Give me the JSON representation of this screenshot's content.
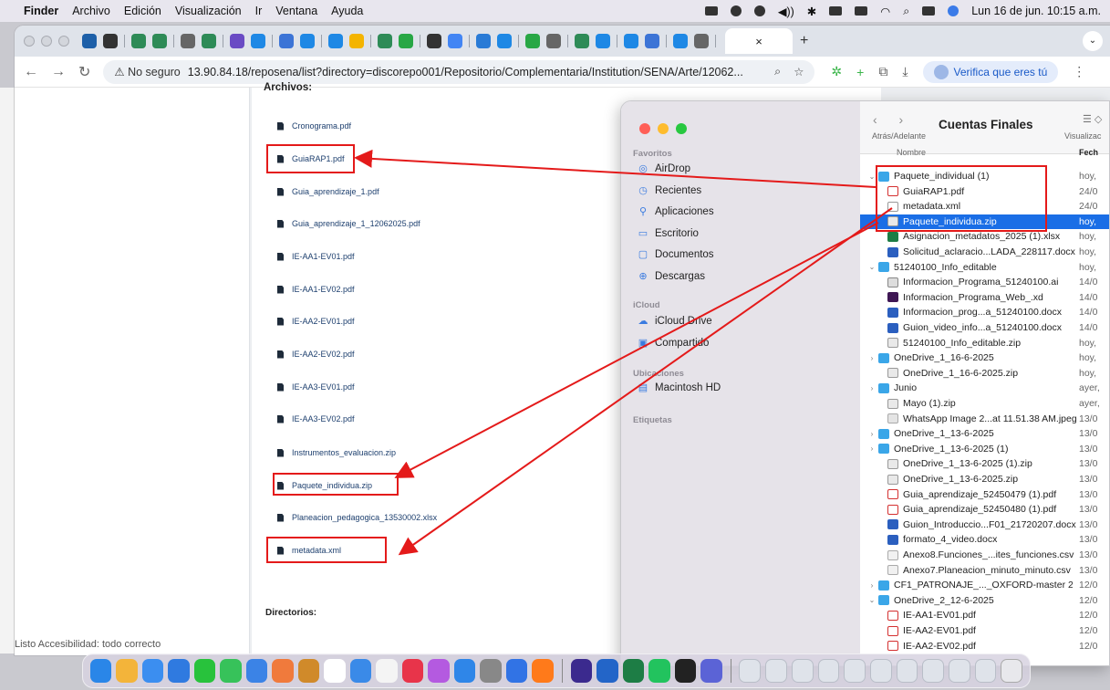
{
  "menubar": {
    "items": [
      "Finder",
      "Archivo",
      "Edición",
      "Visualización",
      "Ir",
      "Ventana",
      "Ayuda"
    ],
    "datetime": "Lun 16 de jun.  10:15 a.m."
  },
  "browser": {
    "tab_close": "×",
    "new_tab": "+",
    "security": "⚠ No seguro",
    "url": "13.90.84.18/reposena/list?directory=discorepo001/Repositorio/Complementaria/Institution/SENA/Arte/12062...",
    "verify_label": "Verifica que eres tú"
  },
  "doc": {
    "heading": "Archivos:",
    "files": [
      "Cronograma.pdf",
      "GuiaRAP1.pdf",
      "Guia_aprendizaje_1.pdf",
      "Guia_aprendizaje_1_12062025.pdf",
      "IE-AA1-EV01.pdf",
      "IE-AA1-EV02.pdf",
      "IE-AA2-EV01.pdf",
      "IE-AA2-EV02.pdf",
      "IE-AA3-EV01.pdf",
      "IE-AA3-EV02.pdf",
      "Instrumentos_evaluacion.zip",
      "Paquete_individua.zip",
      "Planeacion_pedagogica_13530002.xlsx",
      "metadata.xml"
    ],
    "dirs_heading": "Directorios:"
  },
  "status": "Listo    Accesibilidad: todo correcto",
  "finder": {
    "title": "Cuentas Finales",
    "nav_label": "Atrás/Adelante",
    "view_label": "Visualizac",
    "col_name": "Nombre",
    "col_date": "Fech",
    "sidebar": {
      "favoritos": "Favoritos",
      "fav_items": [
        "AirDrop",
        "Recientes",
        "Aplicaciones",
        "Escritorio",
        "Documentos",
        "Descargas"
      ],
      "icloud": "iCloud",
      "icloud_items": [
        "iCloud Drive",
        "Compartido"
      ],
      "ubicaciones": "Ubicaciones",
      "ubic_items": [
        "Macintosh HD"
      ],
      "etiquetas": "Etiquetas"
    },
    "rows": [
      {
        "disc": "v",
        "type": "folder",
        "name": "Paquete_individual (1)",
        "date": "hoy,"
      },
      {
        "disc": "",
        "type": "pdf",
        "name": "GuiaRAP1.pdf",
        "date": "24/0"
      },
      {
        "disc": "",
        "type": "xml",
        "name": "metadata.xml",
        "date": "24/0"
      },
      {
        "disc": "",
        "type": "zip",
        "name": "Paquete_individua.zip",
        "date": "hoy,",
        "selected": true
      },
      {
        "disc": "",
        "type": "xlsx",
        "name": "Asignacion_metadatos_2025 (1).xlsx",
        "date": "hoy,"
      },
      {
        "disc": "",
        "type": "docx",
        "name": "Solicitud_aclaracio...LADA_228117.docx",
        "date": "hoy,"
      },
      {
        "disc": "v",
        "type": "folder",
        "name": "51240100_Info_editable",
        "date": "hoy,"
      },
      {
        "disc": "",
        "type": "ai",
        "name": "Informacion_Programa_51240100.ai",
        "date": "14/0"
      },
      {
        "disc": "",
        "type": "xd",
        "name": "Informacion_Programa_Web_.xd",
        "date": "14/0"
      },
      {
        "disc": "",
        "type": "docx",
        "name": "Informacion_prog...a_51240100.docx",
        "date": "14/0"
      },
      {
        "disc": "",
        "type": "docx",
        "name": "Guion_video_info...a_51240100.docx",
        "date": "14/0"
      },
      {
        "disc": "",
        "type": "zip",
        "name": "51240100_Info_editable.zip",
        "date": "hoy,"
      },
      {
        "disc": ">",
        "type": "folder",
        "name": "OneDrive_1_16-6-2025",
        "date": "hoy,"
      },
      {
        "disc": "",
        "type": "zip",
        "name": "OneDrive_1_16-6-2025.zip",
        "date": "hoy,"
      },
      {
        "disc": ">",
        "type": "folder",
        "name": "Junio",
        "date": "ayer,"
      },
      {
        "disc": "",
        "type": "zip",
        "name": "Mayo (1).zip",
        "date": "ayer,"
      },
      {
        "disc": "",
        "type": "jpeg",
        "name": "WhatsApp Image 2...at 11.51.38 AM.jpeg",
        "date": "13/0"
      },
      {
        "disc": ">",
        "type": "folder",
        "name": "OneDrive_1_13-6-2025",
        "date": "13/0"
      },
      {
        "disc": ">",
        "type": "folder",
        "name": "OneDrive_1_13-6-2025 (1)",
        "date": "13/0"
      },
      {
        "disc": "",
        "type": "zip",
        "name": "OneDrive_1_13-6-2025 (1).zip",
        "date": "13/0"
      },
      {
        "disc": "",
        "type": "zip",
        "name": "OneDrive_1_13-6-2025.zip",
        "date": "13/0"
      },
      {
        "disc": "",
        "type": "pdf",
        "name": "Guia_aprendizaje_52450479 (1).pdf",
        "date": "13/0"
      },
      {
        "disc": "",
        "type": "pdf",
        "name": "Guia_aprendizaje_52450480 (1).pdf",
        "date": "13/0"
      },
      {
        "disc": "",
        "type": "docx",
        "name": "Guion_Introduccio...F01_21720207.docx",
        "date": "13/0"
      },
      {
        "disc": "",
        "type": "docx",
        "name": "formato_4_video.docx",
        "date": "13/0"
      },
      {
        "disc": "",
        "type": "csv",
        "name": "Anexo8.Funciones_...ites_funciones.csv",
        "date": "13/0"
      },
      {
        "disc": "",
        "type": "csv",
        "name": "Anexo7.Planeacion_minuto_minuto.csv",
        "date": "13/0"
      },
      {
        "disc": ">",
        "type": "folder",
        "name": "CF1_PATRONAJE_..._OXFORD-master 2",
        "date": "12/0"
      },
      {
        "disc": "v",
        "type": "folder",
        "name": "OneDrive_2_12-6-2025",
        "date": "12/0"
      },
      {
        "disc": "",
        "type": "pdf",
        "name": "IE-AA1-EV01.pdf",
        "date": "12/0"
      },
      {
        "disc": "",
        "type": "pdf",
        "name": "IE-AA2-EV01.pdf",
        "date": "12/0"
      },
      {
        "disc": "",
        "type": "pdf",
        "name": "IE-AA2-EV02.pdf",
        "date": "12/0"
      }
    ]
  },
  "dock": {
    "colors": [
      "#2a86e8",
      "#f3b43a",
      "#3b8ef0",
      "#2f7ae0",
      "#28c23c",
      "#37c25a",
      "#3b83e6",
      "#f07a3c",
      "#d08a2a",
      "#ffffff",
      "#3a8ae8",
      "#f4f4f4",
      "#e8344a",
      "#b45ae0",
      "#2f86e8",
      "#888888",
      "#3173e5",
      "#ff7a1a",
      "#3b2a8e",
      "#2365c8",
      "#1d7d45",
      "#22c35e",
      "#222222",
      "#5b63d6"
    ]
  }
}
